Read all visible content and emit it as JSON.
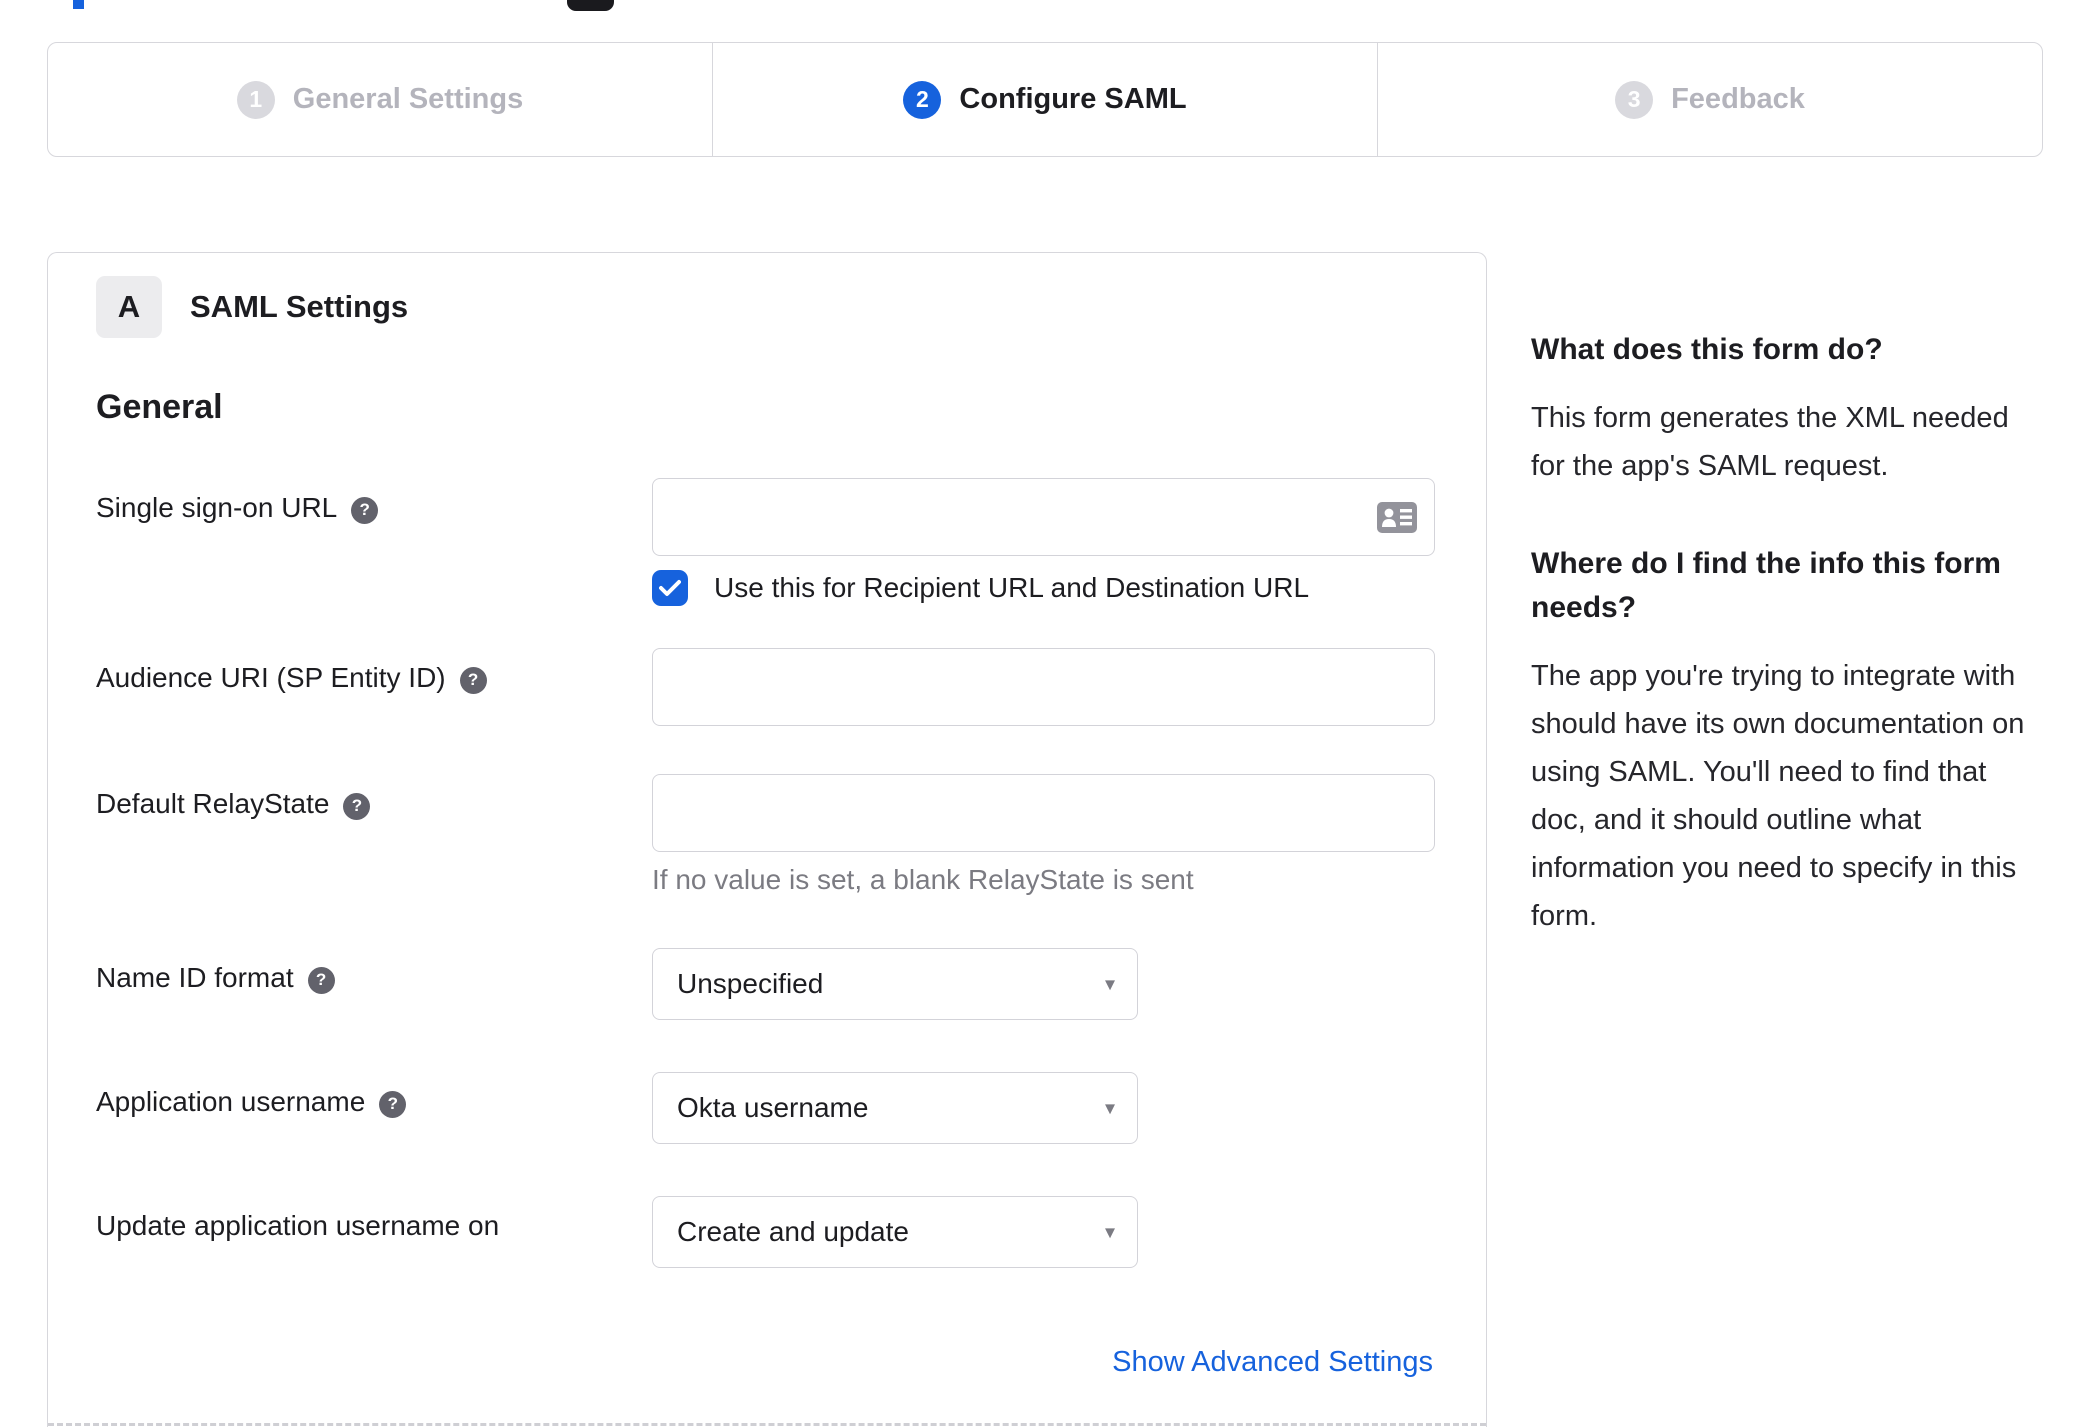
{
  "colors": {
    "accent": "#1662dd",
    "text": "#1d1d21",
    "muted": "#6e6e78",
    "border": "#d7d7dc",
    "inactive_text": "#b4b4bc"
  },
  "icons": {
    "help_glyph": "?",
    "caret_glyph": "▾",
    "input_icon": "contact-card",
    "checkbox_glyph": "checkmark"
  },
  "stepper": {
    "steps": [
      {
        "number": "1",
        "label": "General Settings",
        "state": "inactive"
      },
      {
        "number": "2",
        "label": "Configure SAML",
        "state": "active"
      },
      {
        "number": "3",
        "label": "Feedback",
        "state": "inactive"
      }
    ]
  },
  "panel": {
    "badge": "A",
    "title": "SAML Settings",
    "section_heading": "General",
    "fields": [
      {
        "label": "Single sign-on URL",
        "value": "",
        "checkbox_label": "Use this for Recipient URL and Destination URL",
        "checkbox_checked": true
      },
      {
        "label": "Audience URI (SP Entity ID)",
        "value": ""
      },
      {
        "label": "Default RelayState",
        "value": "",
        "hint": "If no value is set, a blank RelayState is sent"
      },
      {
        "label": "Name ID format",
        "value": "Unspecified"
      },
      {
        "label": "Application username",
        "value": "Okta username"
      },
      {
        "label": "Update application username on",
        "value": "Create and update"
      }
    ],
    "advanced_link": "Show Advanced Settings"
  },
  "sidebar": {
    "sections": [
      {
        "heading": "What does this form do?",
        "body": "This form generates the XML needed for the app's SAML request."
      },
      {
        "heading": "Where do I find the info this form needs?",
        "body": "The app you're trying to integrate with should have its own documentation on using SAML. You'll need to find that doc, and it should outline what information you need to specify in this form."
      }
    ]
  }
}
